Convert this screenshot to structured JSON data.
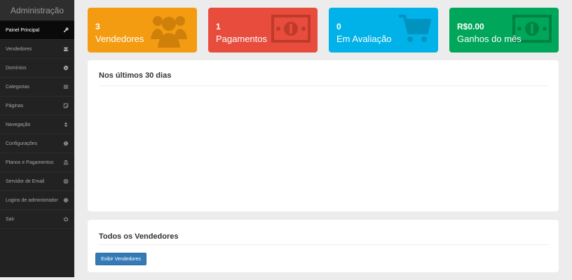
{
  "sidebar": {
    "brand": "Administração",
    "items": [
      {
        "label": "Painel Principal",
        "icon": "wrench-icon",
        "active": true
      },
      {
        "label": "Vendedores",
        "icon": "users-icon"
      },
      {
        "label": "Domínios",
        "icon": "globe-icon"
      },
      {
        "label": "Categorias",
        "icon": "list-icon"
      },
      {
        "label": "Páginas",
        "icon": "page-icon"
      },
      {
        "label": "Navegação",
        "icon": "sort-icon"
      },
      {
        "label": "Configurações",
        "icon": "gear-icon"
      },
      {
        "label": "Planos e Pagamentos",
        "icon": "bank-icon"
      },
      {
        "label": "Servidor de Email",
        "icon": "at-icon"
      },
      {
        "label": "Logins de administrador",
        "icon": "gear-icon"
      },
      {
        "label": "Sair",
        "icon": "power-icon"
      }
    ]
  },
  "cards": [
    {
      "value": "3",
      "label": "Vendedores",
      "color": "#f39c12",
      "icon": "users-icon"
    },
    {
      "value": "1",
      "label": "Pagamentos",
      "color": "#e74c3c",
      "icon": "money-icon"
    },
    {
      "value": "0",
      "label": "Em Avaliação",
      "color": "#00b2e8",
      "icon": "cart-icon"
    },
    {
      "value": "R$0.00",
      "label": "Ganhos do mês",
      "color": "#00a65a",
      "icon": "money-icon"
    }
  ],
  "chart_panel": {
    "title": "Nos últimos 30 dias"
  },
  "vendors_panel": {
    "title": "Todos os Vendedores",
    "button_label": "Exibir Vendedores"
  }
}
